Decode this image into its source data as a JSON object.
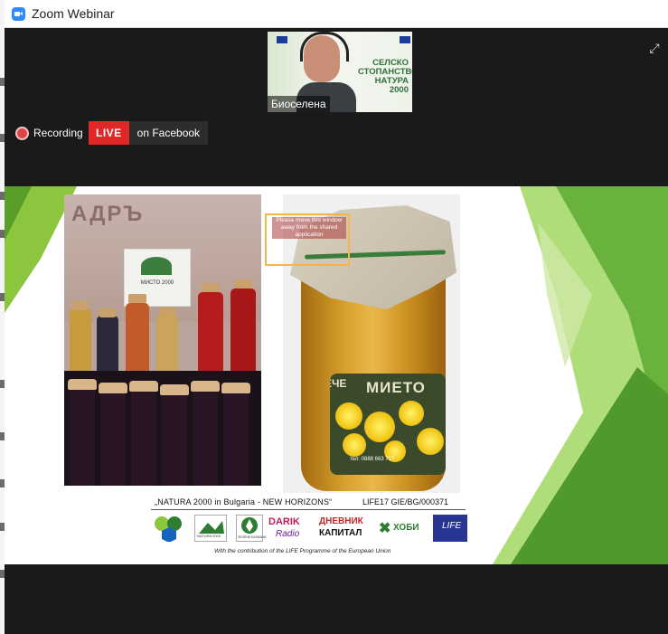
{
  "window": {
    "title": "Zoom Webinar",
    "app_icon": "zoom-icon"
  },
  "speaker": {
    "name": "Биоселена",
    "slogan": "СЕЛСКО СТОПАНСТВО НАТУРА 2000"
  },
  "recording": {
    "label": "Recording"
  },
  "live": {
    "badge": "LIVE",
    "destination": "on Facebook"
  },
  "slide": {
    "share_notice": "Please move this window away from the shared application",
    "left_sign": "АДРЪ",
    "left_card": "МИСТО 2000",
    "jar_brand_left": "ЕЧЕ",
    "jar_brand": "МИЕТО",
    "jar_phone": "тел: 0888 663 717",
    "caption": "„NATURA 2000 in Bulgaria - NEW HORIZONS“",
    "project_code": "LIFE17 GIE/BG/000371",
    "logos": {
      "natura_text": "NATURA 2000",
      "green_balkans": "ЗЕЛЕНИ БАЛКАНИ",
      "darik_top": "DARIK",
      "darik_bottom": "Radio",
      "dnevnik": "ДНЕВНИК",
      "kapital": "КАПИТАЛ",
      "hobi": "ХОБИ",
      "life": "LIFE"
    },
    "contribution": "With the contribution of the LIFE Programme of the European Union"
  },
  "colors": {
    "live_red": "#e02828",
    "dark_bg": "#1a1a1a",
    "slide_green": "#7cb342"
  }
}
